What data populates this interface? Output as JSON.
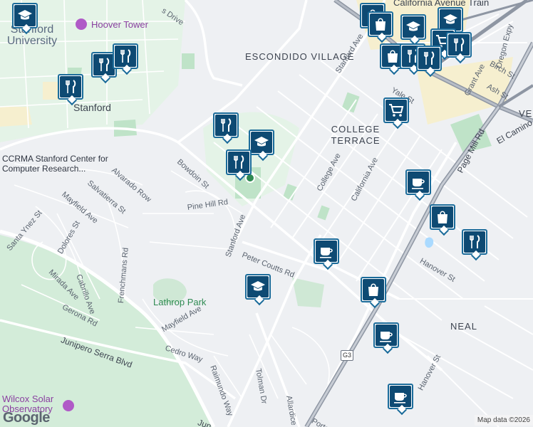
{
  "map": {
    "areas": {
      "escondido": "ESCONDIDO VILLAGE",
      "college_terrace": "COLLEGE TERRACE",
      "neal": "NEAL",
      "vent": "VEN"
    },
    "places": {
      "stanford_university": "Stanford University",
      "stanford": "Stanford",
      "hoover_tower": "Hoover Tower",
      "ccrma": "CCRMA Stanford Center for Computer Research...",
      "lathrop_park": "Lathrop Park",
      "wilcox": "Wilcox Solar Observatory",
      "california_avenue_train": "California Avenue Train"
    },
    "streets": {
      "drive": "s Drive",
      "stanford_ave_north": "Stanford Ave",
      "stanford_ave_south": "Stanford Ave",
      "bowdoin": "Bowdoin St",
      "alvarado": "Alvarado Row",
      "salvatierra": "Salvatierra St",
      "mayfield_n": "Mayfield Ave",
      "mayfield_s": "Mayfield Ave",
      "pine_hill": "Pine Hill Rd",
      "santa_ynez": "Santa Ynez St",
      "dolores": "Dolores St",
      "cabrillo": "Cabrillo Ave",
      "mirada": "Mirada Ave",
      "frenchmans": "Frenchmans Rd",
      "peter_coutts": "Peter Coutts Rd",
      "gerona": "Gerona Rd",
      "junipero": "Junipero Serra Blvd",
      "junipero_s": "Jun",
      "cedro": "Cedro Way",
      "raimundo": "Raimundo Way",
      "tolman": "Tolman Dr",
      "allardice": "Allardice Way",
      "porter": "Porter",
      "college_ave": "College Ave",
      "california_ave": "California Ave",
      "page_mill": "Page Mill Rd",
      "el_camino": "El Camino",
      "hanover_n": "Hanover St",
      "hanover_s": "Hanover St",
      "yale": "Yale St",
      "grant": "Grant Ave",
      "ash": "Ash St",
      "birch": "Birch St",
      "oregon": "Oregon Expy"
    },
    "route_shield": "G3",
    "attribution": "Map data ©2026",
    "logo": "Google",
    "colors": {
      "background": "#eef0f3",
      "park": "#bfe3c8",
      "campus": "#def2e3",
      "commercial": "#f6efcf",
      "highway": "#8e96a3",
      "marker_border": "#1a6b9a",
      "marker_fill": "#0e4a73"
    }
  },
  "markers": [
    {
      "icon": "school-icon",
      "name": "marker-school-1"
    },
    {
      "icon": "restaurant-icon",
      "name": "marker-restaurant-1"
    },
    {
      "icon": "restaurant-icon",
      "name": "marker-restaurant-2"
    },
    {
      "icon": "restaurant-icon",
      "name": "marker-restaurant-3"
    },
    {
      "icon": "restaurant-icon",
      "name": "marker-restaurant-4"
    },
    {
      "icon": "school-icon",
      "name": "marker-school-2"
    },
    {
      "icon": "restaurant-icon",
      "name": "marker-restaurant-5"
    },
    {
      "icon": "school-icon",
      "name": "marker-school-3"
    },
    {
      "icon": "shopping-cart-icon",
      "name": "marker-grocery-1"
    },
    {
      "icon": "cafe-icon",
      "name": "marker-cafe-1"
    },
    {
      "icon": "shopping-bag-icon",
      "name": "marker-shop-1"
    },
    {
      "icon": "restaurant-icon",
      "name": "marker-restaurant-6"
    },
    {
      "icon": "cafe-icon",
      "name": "marker-cafe-2"
    },
    {
      "icon": "shopping-bag-icon",
      "name": "marker-shop-2"
    },
    {
      "icon": "cafe-icon",
      "name": "marker-cafe-3"
    },
    {
      "icon": "cafe-icon",
      "name": "marker-cafe-4"
    },
    {
      "icon": "shopping-bag-icon",
      "name": "marker-shop-3"
    },
    {
      "icon": "shopping-bag-icon",
      "name": "marker-shop-4"
    },
    {
      "icon": "school-icon",
      "name": "marker-school-4"
    },
    {
      "icon": "restaurant-icon",
      "name": "marker-restaurant-7"
    },
    {
      "icon": "restaurant-icon",
      "name": "marker-restaurant-8"
    },
    {
      "icon": "restaurant-icon",
      "name": "marker-restaurant-9"
    },
    {
      "icon": "school-icon",
      "name": "marker-school-5"
    },
    {
      "icon": "restaurant-icon",
      "name": "marker-restaurant-10"
    },
    {
      "icon": "shopping-cart-icon",
      "name": "marker-grocery-2"
    }
  ]
}
